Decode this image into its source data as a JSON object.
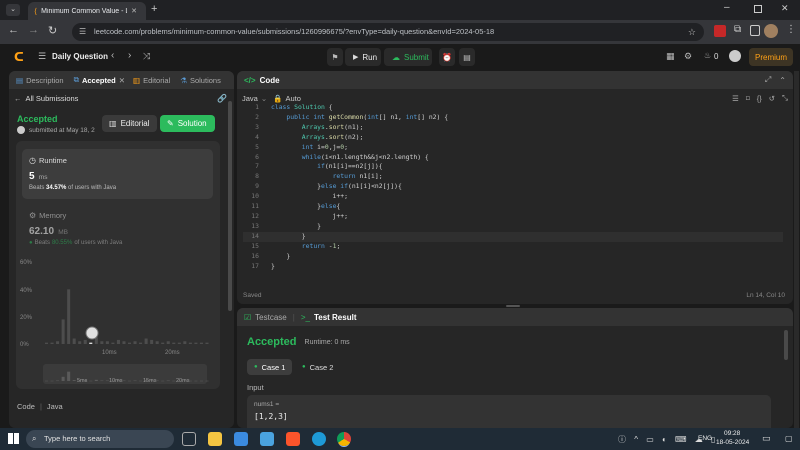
{
  "browser": {
    "tab_title": "Minimum Common Value - Lee",
    "url": "leetcode.com/problems/minimum-common-value/submissions/1260996675/?envType=daily-question&envId=2024-05-18"
  },
  "nav": {
    "title": "Daily Question",
    "run_label": "Run",
    "submit_label": "Submit",
    "streak": "0",
    "premium_label": "Premium"
  },
  "left_tabs": [
    "Description",
    "Accepted",
    "Editorial",
    "Solutions"
  ],
  "submission": {
    "back_label": "All Submissions",
    "status": "Accepted",
    "submitted_text": "submitted at May 18, 2",
    "editorial_label": "Editorial",
    "solution_label": "Solution",
    "runtime_label": "Runtime",
    "runtime_value": "5",
    "runtime_unit": "ms",
    "beats_prefix": "Beats",
    "runtime_beats": "34.57%",
    "beats_suffix": "of users with Java",
    "memory_label": "Memory",
    "memory_value": "62.10",
    "memory_unit": "MB",
    "memory_beats": "80.55%",
    "code_label": "Code",
    "lang_label": "Java"
  },
  "chart_data": {
    "type": "bar",
    "y_ticks": [
      "60%",
      "40%",
      "20%",
      "0%"
    ],
    "ylim": [
      0,
      60
    ],
    "x_ticks": [
      "10ms",
      "20ms"
    ],
    "mini_ticks": [
      "5ms",
      "10ms",
      "15ms",
      "20ms"
    ],
    "values": [
      1,
      1,
      2,
      18,
      40,
      4,
      2,
      3,
      1,
      5,
      2,
      2,
      1,
      3,
      2,
      1,
      2,
      1,
      4,
      3,
      2,
      1,
      2,
      1,
      1,
      2,
      1,
      1,
      1,
      1
    ],
    "highlight_index": 8
  },
  "editor": {
    "title": "Code",
    "lang": "Java",
    "mode": "Auto",
    "saved": "Saved",
    "cursor": "Ln 14, Col 10"
  },
  "code_lines": [
    "class Solution {",
    "    public int getCommon(int[] n1, int[] n2) {",
    "        Arrays.sort(n1);",
    "        Arrays.sort(n2);",
    "        int i=0,j=0;",
    "        while(i<n1.length&&j<n2.length) {",
    "            if(n1[i]==n2[j]){",
    "                return n1[i];",
    "            }else if(n1[i]<n2[j]){",
    "                i++;",
    "            }else{",
    "                j++;",
    "            }",
    "        }",
    "        return -1;",
    "    }",
    "}"
  ],
  "test": {
    "tab_testcase": "Testcase",
    "tab_result": "Test Result",
    "status": "Accepted",
    "runtime_text": "Runtime: 0 ms",
    "case1": "Case 1",
    "case2": "Case 2",
    "input_label": "Input",
    "var_name": "nums1 =",
    "var_value": "[1,2,3]"
  },
  "taskbar": {
    "search_placeholder": "Type here to search",
    "lang": "ENG",
    "time": "09:28",
    "date": "18-05-2024"
  }
}
